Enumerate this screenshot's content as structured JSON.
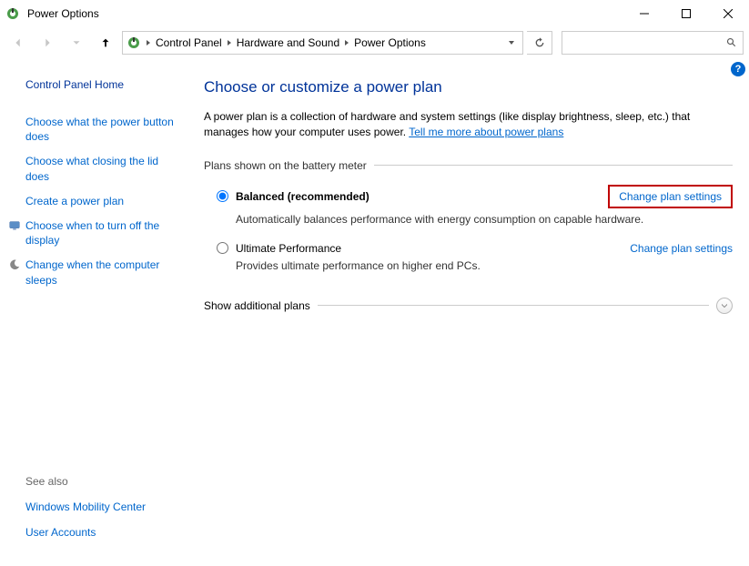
{
  "window": {
    "title": "Power Options"
  },
  "breadcrumbs": [
    "Control Panel",
    "Hardware and Sound",
    "Power Options"
  ],
  "sidebar": {
    "home": "Control Panel Home",
    "links": [
      "Choose what the power button does",
      "Choose what closing the lid does",
      "Create a power plan",
      "Choose when to turn off the display",
      "Change when the computer sleeps"
    ],
    "see_also": "See also",
    "bottom": [
      "Windows Mobility Center",
      "User Accounts"
    ]
  },
  "main": {
    "heading": "Choose or customize a power plan",
    "description_prefix": "A power plan is a collection of hardware and system settings (like display brightness, sleep, etc.) that manages how your computer uses power. ",
    "description_link": "Tell me more about power plans",
    "plans_label": "Plans shown on the battery meter",
    "plans": [
      {
        "name": "Balanced (recommended)",
        "desc": "Automatically balances performance with energy consumption on capable hardware.",
        "selected": true,
        "change": "Change plan settings",
        "highlighted": true
      },
      {
        "name": "Ultimate Performance",
        "desc": "Provides ultimate performance on higher end PCs.",
        "selected": false,
        "change": "Change plan settings",
        "highlighted": false
      }
    ],
    "show_additional": "Show additional plans"
  }
}
